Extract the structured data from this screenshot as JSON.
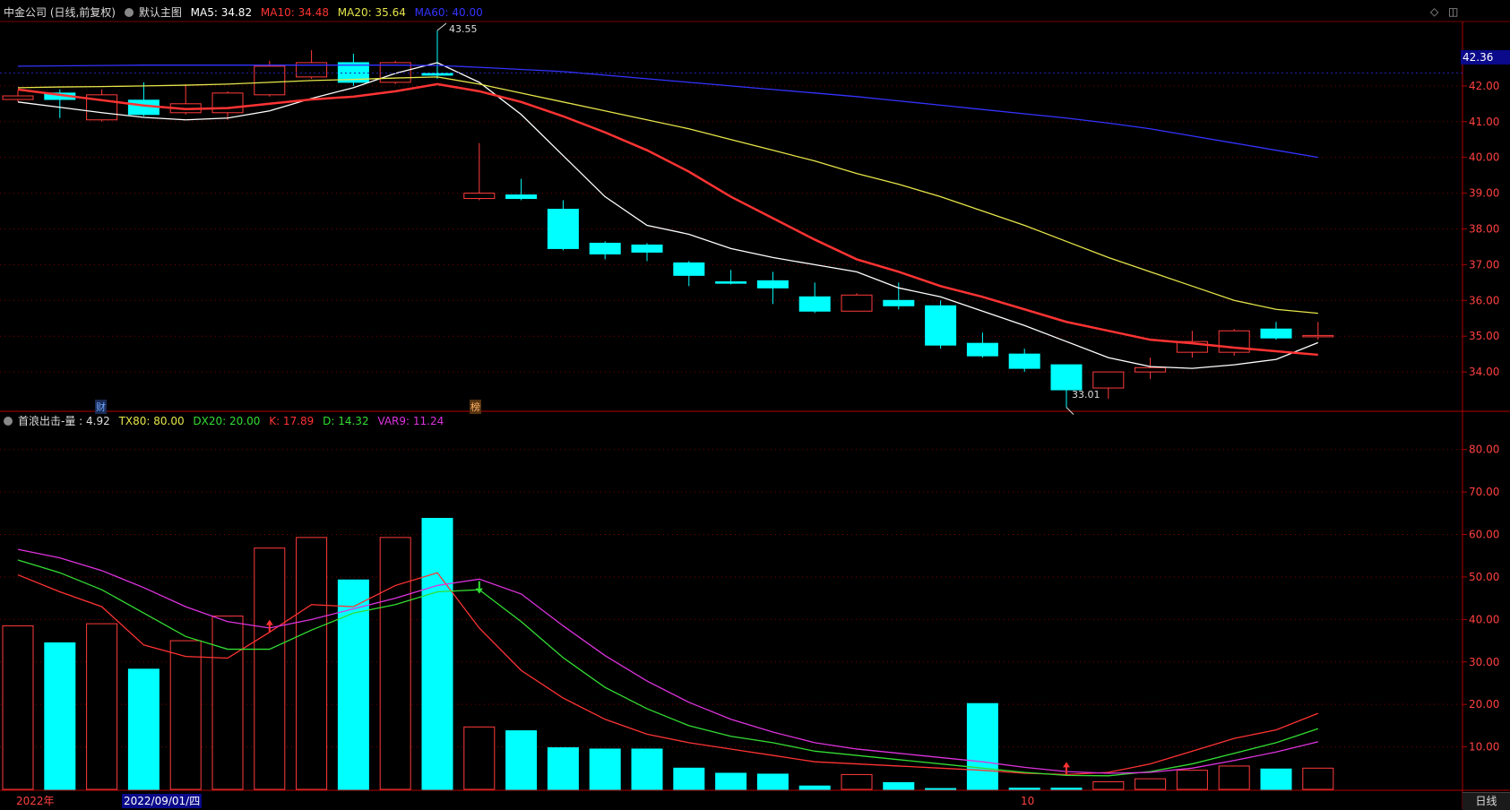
{
  "header": {
    "title": "中金公司 (日线,前复权)",
    "chart_name": "默认主图",
    "ma5": {
      "label": "MA5: 34.82",
      "color": "#ffffff"
    },
    "ma10": {
      "label": "MA10: 34.48",
      "color": "#ff3333"
    },
    "ma20": {
      "label": "MA20: 35.64",
      "color": "#e5e54a"
    },
    "ma60": {
      "label": "MA60: 40.00",
      "color": "#3333ff"
    }
  },
  "indicator_header": {
    "name": "首浪出击-量 : 4.92",
    "tx80": {
      "label": "TX80: 80.00",
      "color": "#e5e54a"
    },
    "dx20": {
      "label": "DX20: 20.00",
      "color": "#33dd33"
    },
    "k": {
      "label": "K: 17.89",
      "color": "#ff3333"
    },
    "d": {
      "label": "D: 14.32",
      "color": "#33dd33"
    },
    "var9": {
      "label": "VAR9: 11.24",
      "color": "#dd33dd"
    }
  },
  "current_price": "42.36",
  "high_label": "43.55",
  "low_label": "33.01",
  "markers": {
    "cai": "财",
    "bang": "榜"
  },
  "bottom": {
    "year": "2022年",
    "date": "2022/09/01/四",
    "month": "10",
    "period_button": "日线"
  },
  "colors": {
    "up": "#ff3b3b",
    "down": "#00ffff",
    "grid": "#7a0000",
    "axis_text": "#ff4040"
  },
  "chart_data": [
    {
      "type": "candlestick",
      "title": "中金公司 (日线,前复权)",
      "ylim": [
        33.0,
        43.6
      ],
      "yticks": [
        34.0,
        35.0,
        36.0,
        37.0,
        38.0,
        39.0,
        40.0,
        41.0,
        42.0
      ],
      "candles": [
        {
          "o": 41.62,
          "c": 41.72,
          "h": 41.88,
          "l": 41.55
        },
        {
          "o": 41.8,
          "c": 41.62,
          "h": 41.9,
          "l": 41.1
        },
        {
          "o": 41.05,
          "c": 41.75,
          "h": 41.9,
          "l": 41.0
        },
        {
          "o": 41.6,
          "c": 41.2,
          "h": 42.1,
          "l": 41.15
        },
        {
          "o": 41.25,
          "c": 41.5,
          "h": 42.05,
          "l": 41.2
        },
        {
          "o": 41.25,
          "c": 41.8,
          "h": 41.85,
          "l": 41.05
        },
        {
          "o": 41.75,
          "c": 42.55,
          "h": 42.7,
          "l": 41.7
        },
        {
          "o": 42.25,
          "c": 42.65,
          "h": 43.0,
          "l": 42.2
        },
        {
          "o": 42.65,
          "c": 42.1,
          "h": 42.9,
          "l": 42.0
        },
        {
          "o": 42.1,
          "c": 42.65,
          "h": 42.7,
          "l": 42.05
        },
        {
          "o": 42.35,
          "c": 42.3,
          "h": 43.55,
          "l": 42.2
        },
        {
          "o": 38.85,
          "c": 39.0,
          "h": 40.4,
          "l": 38.8
        },
        {
          "o": 38.95,
          "c": 38.85,
          "h": 39.4,
          "l": 38.8
        },
        {
          "o": 38.55,
          "c": 37.45,
          "h": 38.8,
          "l": 37.4
        },
        {
          "o": 37.6,
          "c": 37.3,
          "h": 37.65,
          "l": 37.15
        },
        {
          "o": 37.55,
          "c": 37.35,
          "h": 37.6,
          "l": 37.1
        },
        {
          "o": 37.05,
          "c": 36.7,
          "h": 37.1,
          "l": 36.4
        },
        {
          "o": 36.52,
          "c": 36.48,
          "h": 36.85,
          "l": 36.45
        },
        {
          "o": 36.55,
          "c": 36.35,
          "h": 36.8,
          "l": 35.9
        },
        {
          "o": 36.1,
          "c": 35.7,
          "h": 36.5,
          "l": 35.65
        },
        {
          "o": 35.7,
          "c": 36.15,
          "h": 36.2,
          "l": 35.7
        },
        {
          "o": 36.0,
          "c": 35.85,
          "h": 36.5,
          "l": 35.75
        },
        {
          "o": 35.85,
          "c": 34.75,
          "h": 36.0,
          "l": 34.65
        },
        {
          "o": 34.8,
          "c": 34.45,
          "h": 35.1,
          "l": 34.4
        },
        {
          "o": 34.5,
          "c": 34.1,
          "h": 34.65,
          "l": 34.0
        },
        {
          "o": 34.2,
          "c": 33.5,
          "h": 34.2,
          "l": 33.01
        },
        {
          "o": 33.55,
          "c": 34.0,
          "h": 34.0,
          "l": 33.25
        },
        {
          "o": 34.0,
          "c": 34.12,
          "h": 34.4,
          "l": 33.8
        },
        {
          "o": 34.55,
          "c": 34.85,
          "h": 35.15,
          "l": 34.4
        },
        {
          "o": 34.55,
          "c": 35.15,
          "h": 35.2,
          "l": 34.45
        },
        {
          "o": 35.2,
          "c": 34.95,
          "h": 35.4,
          "l": 34.9
        },
        {
          "o": 35.0,
          "c": 35.02,
          "h": 35.4,
          "l": 34.9
        }
      ],
      "series": [
        {
          "name": "MA5",
          "color": "#ffffff",
          "values": [
            41.55,
            41.4,
            41.25,
            41.12,
            41.05,
            41.1,
            41.3,
            41.65,
            41.95,
            42.35,
            42.65,
            42.1,
            41.2,
            40.05,
            38.9,
            38.1,
            37.85,
            37.45,
            37.2,
            37.0,
            36.8,
            36.35,
            36.1,
            35.7,
            35.3,
            34.85,
            34.4,
            34.15,
            34.1,
            34.2,
            34.35,
            34.82
          ]
        },
        {
          "name": "MA10",
          "color": "#ff3333",
          "values": [
            41.9,
            41.75,
            41.6,
            41.45,
            41.35,
            41.38,
            41.5,
            41.62,
            41.7,
            41.85,
            42.05,
            41.85,
            41.55,
            41.15,
            40.7,
            40.2,
            39.6,
            38.9,
            38.3,
            37.7,
            37.15,
            36.8,
            36.4,
            36.1,
            35.75,
            35.4,
            35.15,
            34.9,
            34.8,
            34.68,
            34.58,
            34.48
          ]
        },
        {
          "name": "MA20",
          "color": "#e5e54a",
          "values": [
            41.95,
            41.97,
            41.98,
            42.0,
            42.02,
            42.05,
            42.1,
            42.15,
            42.18,
            42.22,
            42.25,
            42.05,
            41.8,
            41.55,
            41.3,
            41.05,
            40.8,
            40.5,
            40.2,
            39.9,
            39.55,
            39.25,
            38.9,
            38.5,
            38.1,
            37.65,
            37.2,
            36.8,
            36.4,
            36.0,
            35.75,
            35.64
          ]
        },
        {
          "name": "MA60",
          "color": "#3333ff",
          "values": [
            42.55,
            42.56,
            42.57,
            42.58,
            42.58,
            42.58,
            42.58,
            42.58,
            42.58,
            42.58,
            42.57,
            42.52,
            42.46,
            42.4,
            42.3,
            42.2,
            42.1,
            42.0,
            41.9,
            41.8,
            41.7,
            41.58,
            41.46,
            41.34,
            41.22,
            41.1,
            40.96,
            40.8,
            40.6,
            40.4,
            40.2,
            40.0
          ]
        }
      ]
    },
    {
      "type": "bar",
      "title": "首浪出击-量",
      "ylim": [
        0,
        85
      ],
      "yticks": [
        10,
        20,
        30,
        40,
        50,
        60,
        70,
        80
      ],
      "volumes": [
        38.5,
        34.5,
        39.0,
        28.3,
        35.0,
        40.8,
        56.8,
        59.3,
        49.3,
        59.3,
        63.8,
        14.7,
        13.8,
        9.8,
        9.5,
        9.5,
        5.0,
        3.8,
        3.6,
        0.8,
        3.5,
        1.6,
        0.2,
        20.2,
        0.3,
        0.3,
        1.8,
        2.5,
        4.5,
        5.5,
        4.8,
        5.0
      ],
      "series": [
        {
          "name": "K",
          "color": "#ff3333",
          "values": [
            50.5,
            46.5,
            43.0,
            34.0,
            31.3,
            30.9,
            37.0,
            43.5,
            43.0,
            48.0,
            51.0,
            38.0,
            28.0,
            21.5,
            16.5,
            13.0,
            11.0,
            9.5,
            8.0,
            6.5,
            6.0,
            5.5,
            5.0,
            4.5,
            3.8,
            3.5,
            4.0,
            6.0,
            9.0,
            12.0,
            14.0,
            17.9
          ]
        },
        {
          "name": "D",
          "color": "#33dd33",
          "values": [
            54.0,
            51.0,
            47.0,
            41.5,
            36.0,
            33.0,
            33.0,
            37.5,
            41.5,
            43.5,
            46.5,
            47.0,
            39.5,
            31.0,
            24.0,
            19.0,
            15.0,
            12.5,
            11.0,
            9.0,
            8.0,
            7.0,
            6.0,
            5.0,
            4.0,
            3.3,
            3.2,
            4.2,
            6.0,
            8.5,
            11.0,
            14.3
          ]
        },
        {
          "name": "VAR9",
          "color": "#dd33dd",
          "values": [
            56.5,
            54.5,
            51.5,
            47.5,
            43.0,
            39.5,
            38.0,
            40.0,
            42.5,
            45.0,
            48.0,
            49.5,
            46.0,
            38.5,
            31.5,
            25.5,
            20.5,
            16.5,
            13.5,
            11.0,
            9.5,
            8.5,
            7.5,
            6.5,
            5.2,
            4.2,
            3.8,
            4.0,
            5.0,
            6.8,
            8.8,
            11.2
          ]
        }
      ]
    }
  ]
}
